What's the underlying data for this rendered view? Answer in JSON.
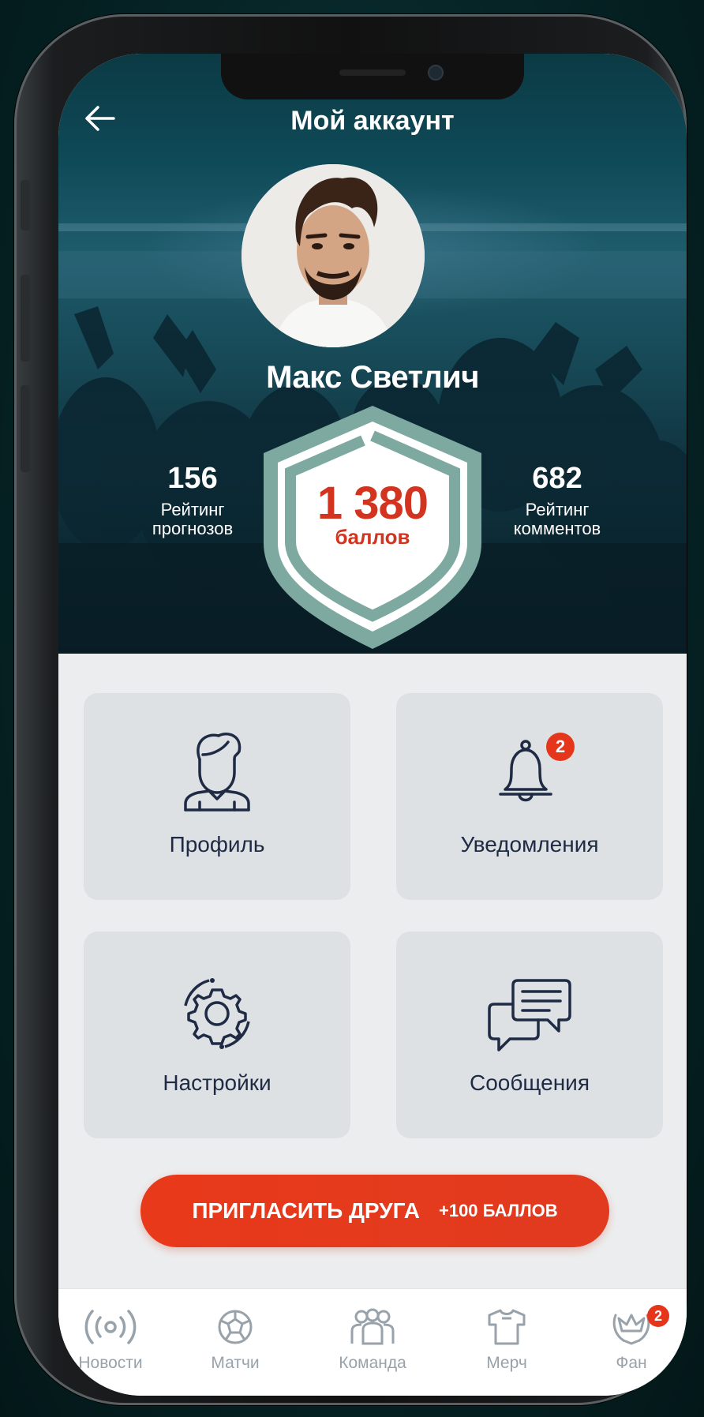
{
  "header": {
    "title": "Мой аккаунт"
  },
  "profile": {
    "name": "Макс Светлич",
    "points_value": "1 380",
    "points_label": "баллов"
  },
  "stats": {
    "left": {
      "value": "156",
      "label_line1": "Рейтинг",
      "label_line2": "прогнозов"
    },
    "right": {
      "value": "682",
      "label_line1": "Рейтинг",
      "label_line2": "комментов"
    }
  },
  "menu": [
    {
      "label": "Профиль",
      "icon": "person-icon"
    },
    {
      "label": "Уведомления",
      "icon": "bell-icon",
      "badge": "2"
    },
    {
      "label": "Настройки",
      "icon": "gear-icon"
    },
    {
      "label": "Сообщения",
      "icon": "chat-icon"
    }
  ],
  "invite": {
    "label": "ПРИГЛАСИТЬ ДРУГА",
    "bonus": "+100 БАЛЛОВ"
  },
  "tabbar": [
    {
      "label": "Новости",
      "icon": "broadcast-icon"
    },
    {
      "label": "Матчи",
      "icon": "ball-icon"
    },
    {
      "label": "Команда",
      "icon": "team-icon"
    },
    {
      "label": "Мерч",
      "icon": "shirt-icon"
    },
    {
      "label": "Фан",
      "icon": "crown-icon",
      "badge": "2"
    }
  ],
  "colors": {
    "accent": "#e5361b",
    "shield": "#7ea9a1",
    "tile": "#dde1e3",
    "text_dark": "#1f2a44",
    "tab_inactive": "#98a2ab"
  }
}
